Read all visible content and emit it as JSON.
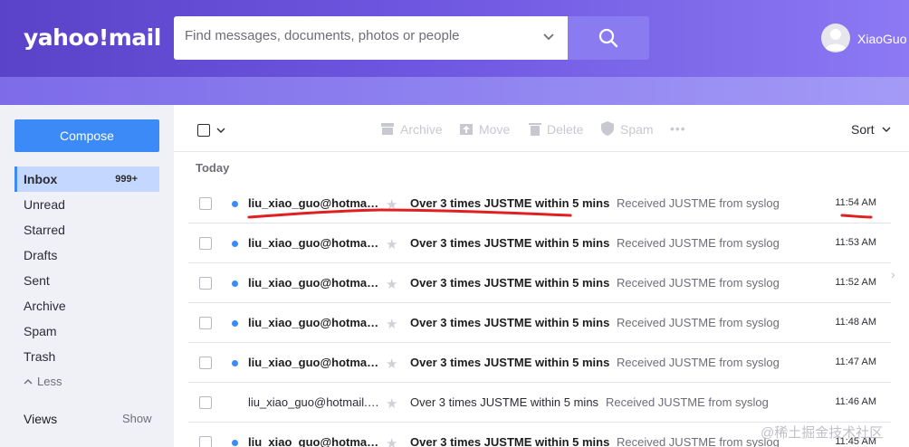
{
  "app": {
    "logo_text": "yahoo!mail",
    "username": "XiaoGuo"
  },
  "search": {
    "placeholder": "Find messages, documents, photos or people"
  },
  "sidebar": {
    "compose_label": "Compose",
    "items": [
      {
        "label": "Inbox",
        "count": "999+",
        "active": true
      },
      {
        "label": "Unread"
      },
      {
        "label": "Starred"
      },
      {
        "label": "Drafts"
      },
      {
        "label": "Sent"
      },
      {
        "label": "Archive"
      },
      {
        "label": "Spam"
      },
      {
        "label": "Trash"
      }
    ],
    "less_label": "Less",
    "views_label": "Views",
    "views_action": "Show"
  },
  "toolbar": {
    "archive": "Archive",
    "move": "Move",
    "delete": "Delete",
    "spam": "Spam",
    "more": "•••",
    "sort": "Sort"
  },
  "list": {
    "group_label": "Today",
    "messages": [
      {
        "sender": "liu_xiao_guo@hotmail.com",
        "subject": "Over 3 times JUSTME within 5 mins",
        "preview": "Received JUSTME from syslog",
        "time": "11:54 AM",
        "unread": true
      },
      {
        "sender": "liu_xiao_guo@hotmail.com",
        "subject": "Over 3 times JUSTME within 5 mins",
        "preview": "Received JUSTME from syslog",
        "time": "11:53 AM",
        "unread": true
      },
      {
        "sender": "liu_xiao_guo@hotmail.com",
        "subject": "Over 3 times JUSTME within 5 mins",
        "preview": "Received JUSTME from syslog",
        "time": "11:52 AM",
        "unread": true
      },
      {
        "sender": "liu_xiao_guo@hotmail.com",
        "subject": "Over 3 times JUSTME within 5 mins",
        "preview": "Received JUSTME from syslog",
        "time": "11:48 AM",
        "unread": true
      },
      {
        "sender": "liu_xiao_guo@hotmail.com",
        "subject": "Over 3 times JUSTME within 5 mins",
        "preview": "Received JUSTME from syslog",
        "time": "11:47 AM",
        "unread": true
      },
      {
        "sender": "liu_xiao_guo@hotmail.com",
        "subject": "Over 3 times JUSTME within 5 mins",
        "preview": "Received JUSTME from syslog",
        "time": "11:46 AM",
        "unread": false
      },
      {
        "sender": "liu_xiao_guo@hotmail.com",
        "subject": "Over 3 times JUSTME within 5 mins",
        "preview": "Received JUSTME from syslog",
        "time": "11:45 AM",
        "unread": true
      }
    ]
  },
  "watermark": "@稀土掘金技术社区",
  "icons": [
    "search-icon",
    "chevron-down-icon",
    "user-avatar-icon",
    "archive-icon",
    "move-icon",
    "trash-icon",
    "shield-icon",
    "more-icon",
    "star-icon",
    "chevron-right-icon"
  ],
  "colors": {
    "accent": "#3b8af7",
    "header": "#6e56e0",
    "annotation": "#e02020"
  }
}
